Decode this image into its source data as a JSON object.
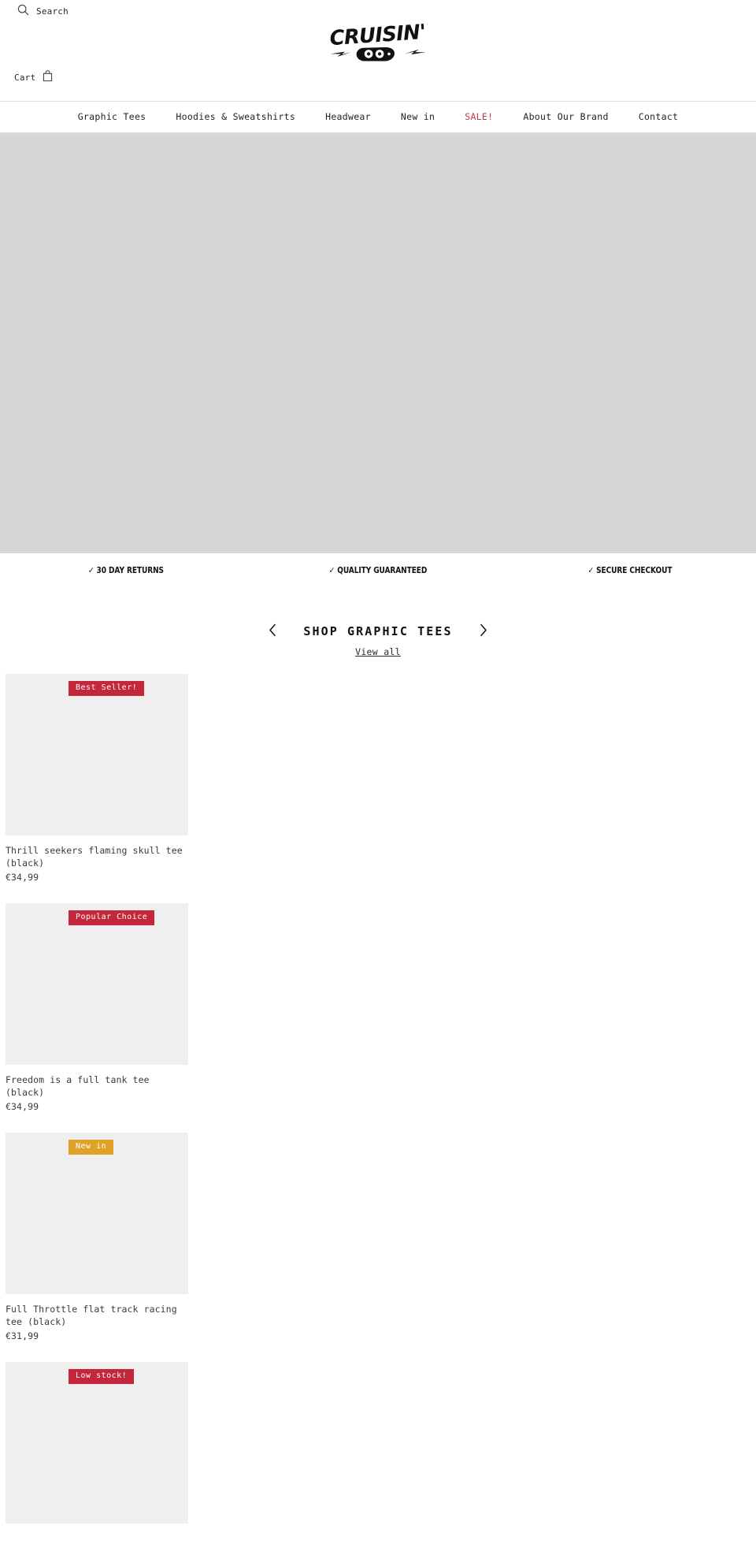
{
  "header": {
    "search": {
      "label": "Search",
      "icon": "search-icon"
    },
    "cart": {
      "label": "Cart",
      "icon": "shopping-bag-icon"
    },
    "logo": {
      "wordmark": "CRUISIN'",
      "badge": "CO"
    }
  },
  "nav": {
    "items": [
      {
        "label": "Graphic Tees",
        "highlight": false
      },
      {
        "label": "Hoodies & Sweatshirts",
        "highlight": false
      },
      {
        "label": "Headwear",
        "highlight": false
      },
      {
        "label": "New in",
        "highlight": false
      },
      {
        "label": "SALE!",
        "highlight": true
      },
      {
        "label": "About Our Brand",
        "highlight": false
      },
      {
        "label": "Contact",
        "highlight": false
      }
    ]
  },
  "trust_bar": {
    "items": [
      "✓ 30 DAY RETURNS",
      "✓ QUALITY GUARANTEED",
      "✓ SECURE CHECKOUT"
    ]
  },
  "carousel": {
    "title": "SHOP GRAPHIC TEES",
    "view_all": "View all",
    "prev_icon": "chevron-left-icon",
    "next_icon": "chevron-right-icon"
  },
  "products": [
    {
      "title": "Thrill seekers flaming skull tee (black)",
      "price": "€34,99",
      "badge": {
        "label": "Best Seller!",
        "color": "red"
      }
    },
    {
      "title": "Freedom is a full tank tee (black)",
      "price": "€34,99",
      "badge": {
        "label": "Popular Choice",
        "color": "red"
      }
    },
    {
      "title": "Full Throttle flat track racing tee (black)",
      "price": "€31,99",
      "badge": {
        "label": "New in",
        "color": "amber"
      }
    },
    {
      "title": "",
      "price": "",
      "badge": {
        "label": "Low stock!",
        "color": "red"
      }
    }
  ],
  "colors": {
    "sale_red": "#c0394b",
    "badge_red": "#c4263c",
    "badge_amber": "#e0a127",
    "hero_placeholder": "#d6d6d6",
    "thumb_placeholder": "#efefef"
  }
}
